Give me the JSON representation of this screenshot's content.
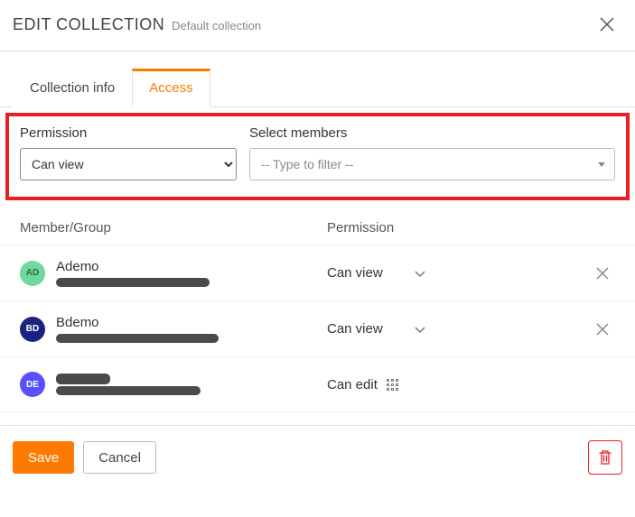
{
  "header": {
    "title": "EDIT COLLECTION",
    "subtitle": "Default collection"
  },
  "tabs": [
    {
      "label": "Collection info",
      "active": false
    },
    {
      "label": "Access",
      "active": true
    }
  ],
  "form": {
    "permission_label": "Permission",
    "permission_value": "Can view",
    "members_label": "Select members",
    "members_placeholder": "-- Type to filter --"
  },
  "table": {
    "headers": {
      "member": "Member/Group",
      "permission": "Permission"
    },
    "rows": [
      {
        "initials": "AD",
        "avatar_color": "green",
        "name": "Ademo",
        "permission": "Can view",
        "dropdown": true,
        "removable": true
      },
      {
        "initials": "BD",
        "avatar_color": "navy",
        "name": "Bdemo",
        "permission": "Can view",
        "dropdown": true,
        "removable": true
      },
      {
        "initials": "DE",
        "avatar_color": "purple",
        "name": "",
        "permission": "Can edit",
        "dropdown": false,
        "removable": false
      }
    ]
  },
  "footer": {
    "save": "Save",
    "cancel": "Cancel"
  }
}
